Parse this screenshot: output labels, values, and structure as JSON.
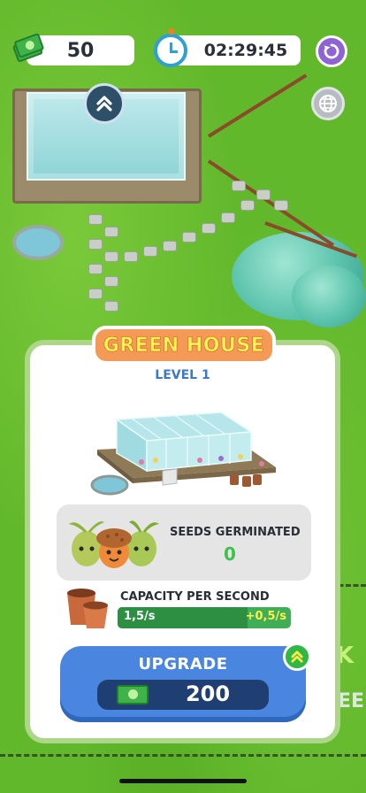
{
  "hud": {
    "money": "50",
    "timer": "02:29:45"
  },
  "panel": {
    "title": "GREEN HOUSE",
    "level": "LEVEL 1",
    "seeds_label": "SEEDS GERMINATED",
    "seeds_value": "0",
    "capacity_label": "CAPACITY PER SECOND",
    "capacity_current": "1,5/s",
    "capacity_bonus": "+0,5/s",
    "capacity_fill_fraction": 0.75,
    "upgrade_label": "UPGRADE",
    "upgrade_cost": "200"
  },
  "side_text": {
    "k": "K",
    "ee": "EE"
  },
  "colors": {
    "grass": "#62b82b",
    "panel_border": "#aed68a",
    "title_banner": "#f49a56",
    "title_text": "#fff454",
    "level_text": "#3b78c8",
    "upgrade_button": "#4a86e0",
    "cost_pill": "#1f3f72",
    "seeds_value": "#3ec24a",
    "capacity_bar": "#3fae57",
    "capacity_bonus": "#fff14d",
    "restart_button": "#8d63d6"
  },
  "icons": {
    "money": "cash-icon",
    "timer": "stopwatch-icon",
    "restart": "restart-icon",
    "language": "globe-icon",
    "building_marker": "double-chevron-up-icon",
    "upgrade_badge": "double-chevron-up-icon"
  }
}
